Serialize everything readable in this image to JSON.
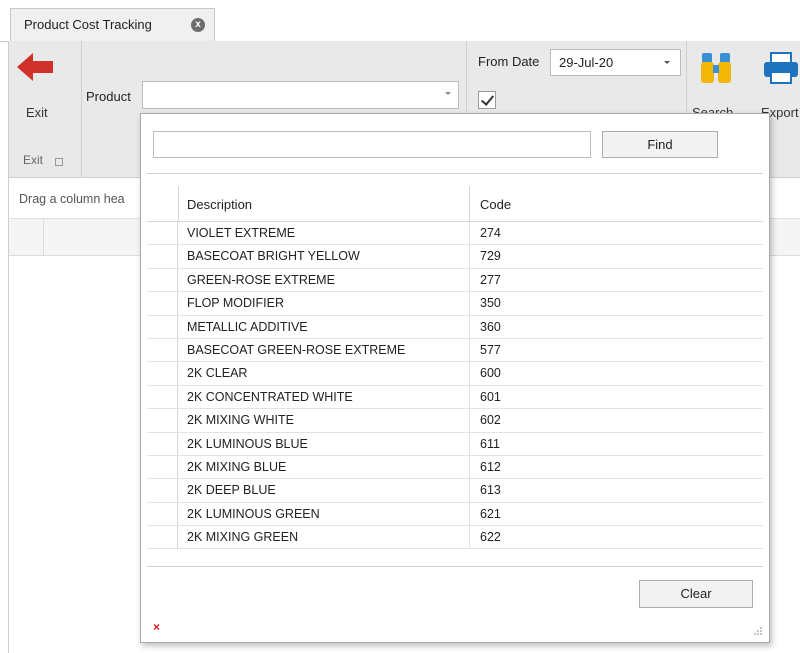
{
  "tab": {
    "title": "Product Cost Tracking"
  },
  "ribbon": {
    "exit_label": "Exit",
    "exit_group": "Exit",
    "product_label": "Product",
    "product_value": "",
    "from_date_label": "From Date",
    "from_date_value": "29-Jul-20",
    "search_label": "Search",
    "export_label": "Export"
  },
  "grid": {
    "drag_hint": "Drag a column hea"
  },
  "popup": {
    "find_value": "",
    "find_button": "Find",
    "clear_button": "Clear",
    "columns": [
      "Description",
      "Code"
    ],
    "rows": [
      {
        "description": "VIOLET EXTREME",
        "code": "274"
      },
      {
        "description": "BASECOAT BRIGHT YELLOW",
        "code": "729"
      },
      {
        "description": "GREEN-ROSE EXTREME",
        "code": "277"
      },
      {
        "description": "FLOP MODIFIER",
        "code": "350"
      },
      {
        "description": "METALLIC ADDITIVE",
        "code": "360"
      },
      {
        "description": "BASECOAT GREEN-ROSE EXTREME",
        "code": "577"
      },
      {
        "description": "2K CLEAR",
        "code": "600"
      },
      {
        "description": "2K CONCENTRATED WHITE",
        "code": "601"
      },
      {
        "description": "2K MIXING WHITE",
        "code": "602"
      },
      {
        "description": "2K LUMINOUS BLUE",
        "code": "611"
      },
      {
        "description": "2K MIXING BLUE",
        "code": "612"
      },
      {
        "description": "2K DEEP BLUE",
        "code": "613"
      },
      {
        "description": "2K LUMINOUS GREEN",
        "code": "621"
      },
      {
        "description": "2K MIXING GREEN",
        "code": "622"
      }
    ],
    "close_glyph": "×"
  },
  "colors": {
    "exit_arrow": "#d0322b",
    "search_icon": "#f2b705",
    "export_icon": "#1e73be"
  }
}
